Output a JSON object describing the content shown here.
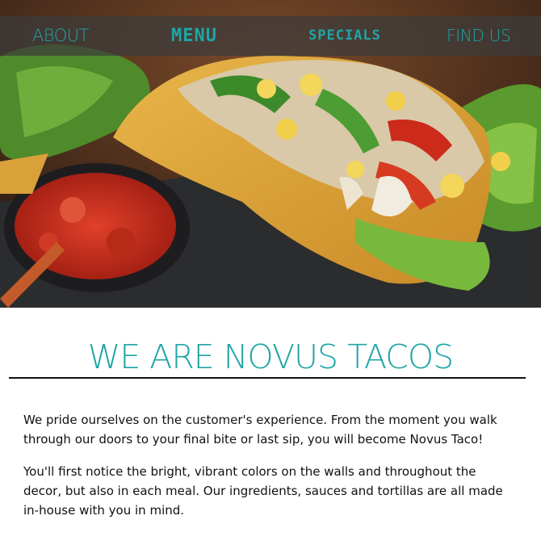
{
  "nav": {
    "items": [
      {
        "label": "ABOUT"
      },
      {
        "label": "MENU"
      },
      {
        "label": "SPECIALS"
      },
      {
        "label": "FIND US"
      }
    ]
  },
  "hero": {
    "image": "taco-with-salsa-photo"
  },
  "main": {
    "title": "WE ARE NOVUS TACOS",
    "paragraphs": [
      "We pride ourselves on the customer's experience. From the moment you walk through our doors to your final bite or last sip, you will become Novus Taco!",
      "You'll first notice the bright, vibrant colors on the walls and throughout the decor, but also in each meal. Our ingredients, sauces and tortillas are all made in-house with you in mind."
    ]
  },
  "colors": {
    "accent": "#1fa5a6",
    "nav_bg": "#3c3c3c",
    "text": "#111111"
  }
}
